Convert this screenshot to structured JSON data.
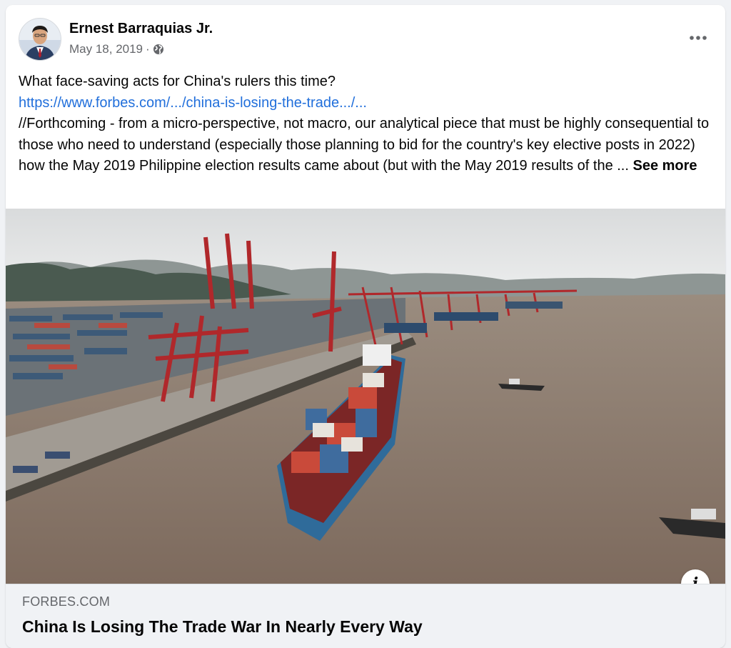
{
  "post": {
    "author": "Ernest Barraquias Jr.",
    "date": "May 18, 2019",
    "separator": "·",
    "privacy_icon": "globe-icon",
    "more_icon": "more-options-icon",
    "text_line1": "What face-saving acts for China's rulers this time?",
    "link": "https://www.forbes.com/.../china-is-losing-the-trade.../...",
    "text_body": "//Forthcoming - from a micro-perspective, not macro, our analytical piece that must be highly consequential to those who need to understand (especially those planning to bid for the country's key elective posts in 2022) how the May 2019 Philippine election results came about (but with the May 2019 results of the ... ",
    "see_more": "See more"
  },
  "link_preview": {
    "domain": "FORBES.COM",
    "title": "China Is Losing The Trade War In Nearly Every Way",
    "info_icon": "info-icon",
    "image": "container-port-photo"
  },
  "colors": {
    "link": "#216fdb",
    "secondary_text": "#65676b",
    "preview_bg": "#f0f2f5"
  }
}
